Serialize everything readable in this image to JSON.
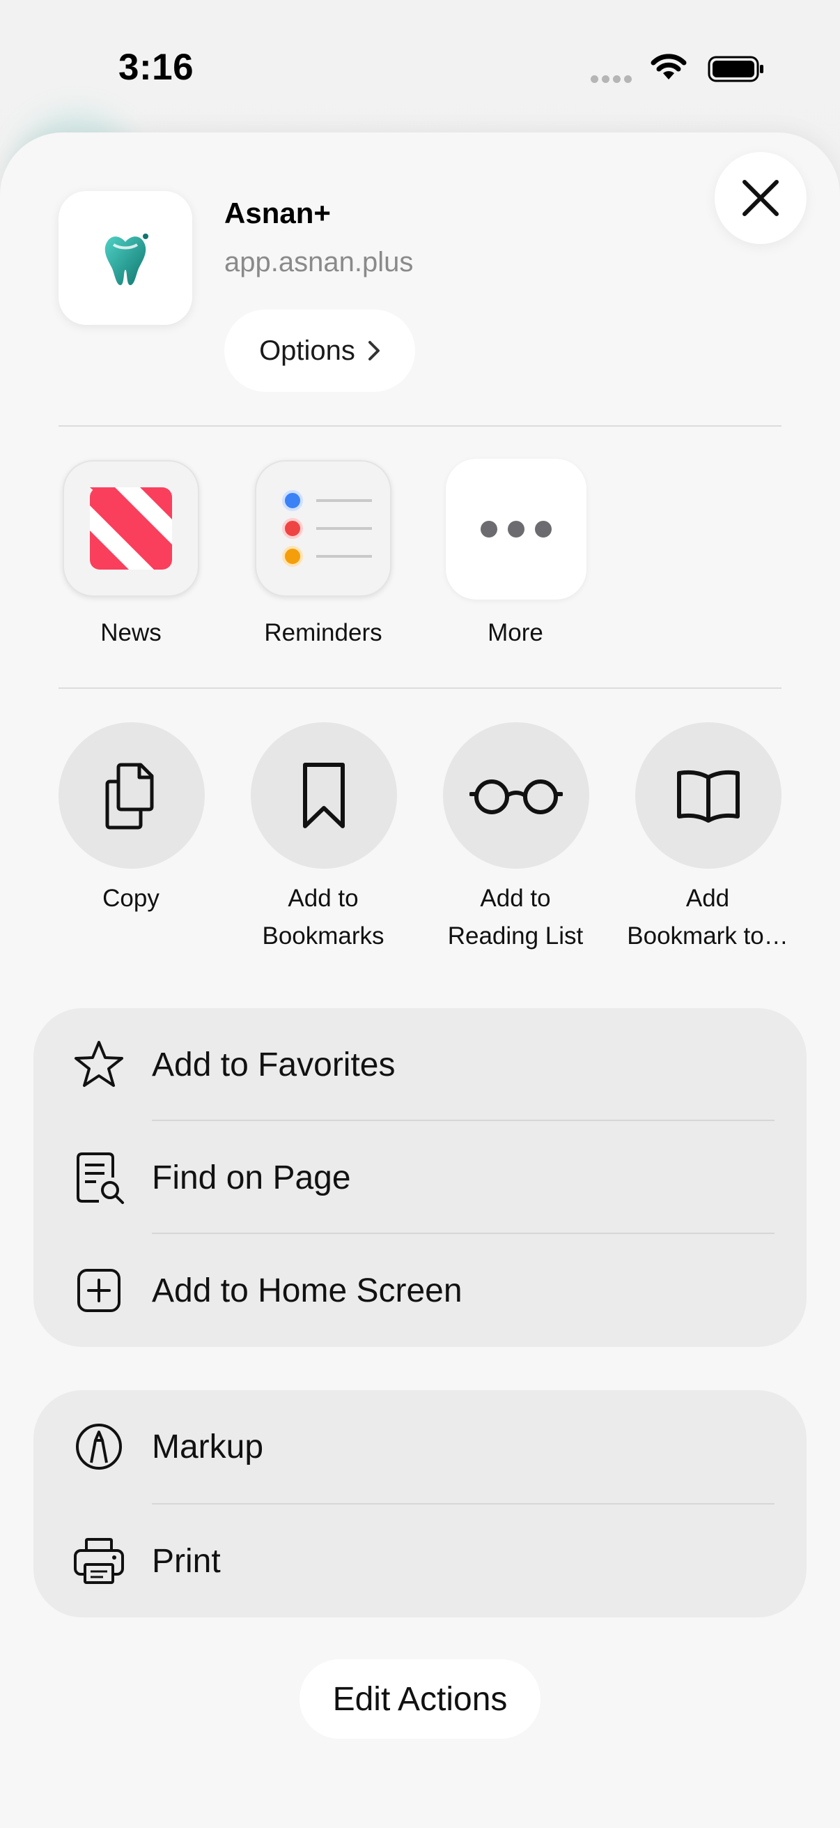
{
  "status_bar": {
    "time": "3:16"
  },
  "share_sheet": {
    "app_title": "Asnan+",
    "app_url": "app.asnan.plus",
    "options_label": "Options",
    "apps": [
      {
        "label": "News",
        "icon": "news-icon"
      },
      {
        "label": "Reminders",
        "icon": "reminders-icon"
      },
      {
        "label": "More",
        "icon": "more-icon"
      }
    ],
    "actions": [
      {
        "line1": "Copy",
        "line2": "",
        "icon": "copy-icon"
      },
      {
        "line1": "Add to",
        "line2": "Bookmarks",
        "icon": "bookmark-icon"
      },
      {
        "line1": "Add to",
        "line2": "Reading List",
        "icon": "glasses-icon"
      },
      {
        "line1": "Add",
        "line2": "Bookmark to…",
        "icon": "book-icon"
      }
    ],
    "group1": [
      {
        "label": "Add to Favorites",
        "icon": "star-icon"
      },
      {
        "label": "Find on Page",
        "icon": "find-page-icon"
      },
      {
        "label": "Add to Home Screen",
        "icon": "add-square-icon"
      }
    ],
    "group2": [
      {
        "label": "Markup",
        "icon": "markup-icon"
      },
      {
        "label": "Print",
        "icon": "printer-icon"
      }
    ],
    "edit_actions_label": "Edit Actions"
  },
  "colors": {
    "news_red": "#fa3f5d",
    "reminder_blue": "#3b82f6",
    "reminder_red": "#ef4444",
    "reminder_orange": "#f59e0b",
    "brand_teal": "#1aa39a"
  }
}
